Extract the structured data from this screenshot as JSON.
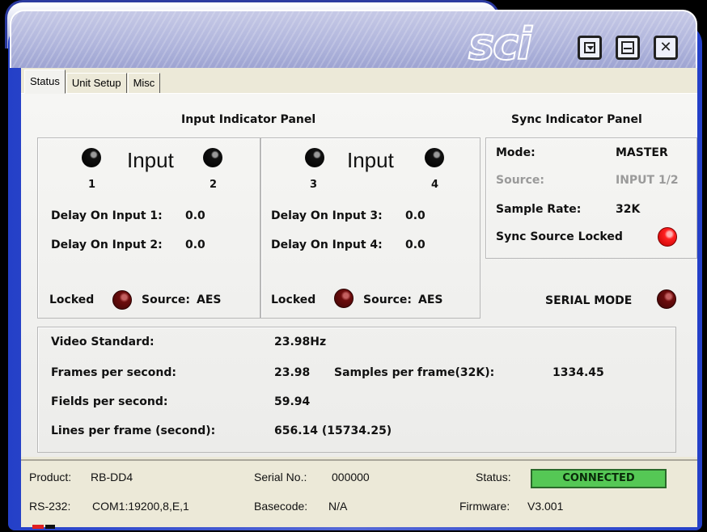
{
  "window": {
    "logo": "sci",
    "buttons": [
      "down-arrow",
      "minimize",
      "close"
    ],
    "close_glyph": "✕"
  },
  "tabs": [
    {
      "label": "Status",
      "active": true
    },
    {
      "label": "Unit Setup",
      "active": false
    },
    {
      "label": "Misc",
      "active": false
    }
  ],
  "input_panel": {
    "title": "Input Indicator Panel",
    "group_a": {
      "heading": "Input",
      "num_left": "1",
      "num_right": "2",
      "delay1_label": "Delay On Input 1:",
      "delay1_value": "0.0",
      "delay2_label": "Delay On Input 2:",
      "delay2_value": "0.0",
      "locked_label": "Locked",
      "source_label": "Source:",
      "source_value": "AES"
    },
    "group_b": {
      "heading": "Input",
      "num_left": "3",
      "num_right": "4",
      "delay1_label": "Delay On Input 3:",
      "delay1_value": "0.0",
      "delay2_label": "Delay On Input 4:",
      "delay2_value": "0.0",
      "locked_label": "Locked",
      "source_label": "Source:",
      "source_value": "AES"
    }
  },
  "sync_panel": {
    "title": "Sync Indicator Panel",
    "mode_label": "Mode:",
    "mode_value": "MASTER",
    "source_label": "Source:",
    "source_value": "INPUT 1/2",
    "rate_label": "Sample Rate:",
    "rate_value": "32K",
    "locked_label": "Sync Source Locked",
    "serial_label": "SERIAL MODE"
  },
  "video": {
    "standard_label": "Video Standard:",
    "standard_value": "23.98Hz",
    "fps_label": "Frames per second:",
    "fps_value": "23.98",
    "spf_label": "Samples per frame(32K):",
    "spf_value": "1334.45",
    "fields_label": "Fields per second:",
    "fields_value": "59.94",
    "lines_label": "Lines per frame (second):",
    "lines_value": "656.14 (15734.25)"
  },
  "statusbar": {
    "product_label": "Product:",
    "product_value": "RB-DD4",
    "serial_label": "Serial No.:",
    "serial_value": "000000",
    "status_label": "Status:",
    "status_value": "CONNECTED",
    "rs232_label": "RS-232:",
    "rs232_value": "COM1:19200,8,E,1",
    "basecode_label": "Basecode:",
    "basecode_value": "N/A",
    "firmware_label": "Firmware:",
    "firmware_value": "V3.001"
  },
  "colors": {
    "frame_blue": "#2440c8",
    "led_on": "#ff2020",
    "led_off": "#6c0c0c",
    "connected_green": "#55c855"
  }
}
